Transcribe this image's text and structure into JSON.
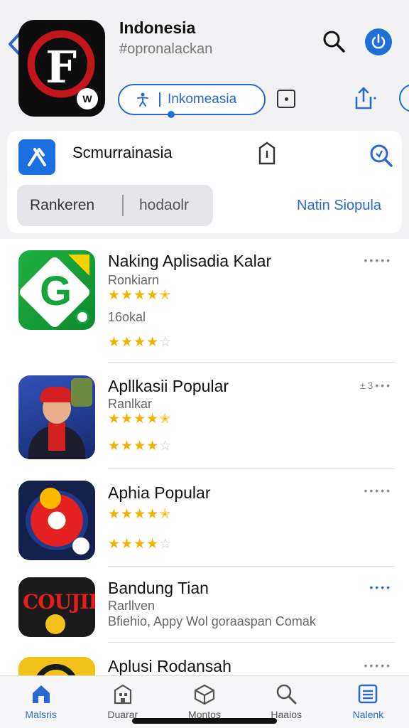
{
  "header": {
    "title": "Indonesia",
    "subtitle": "#opronalackan",
    "app_icon_letter": "F",
    "app_icon_badge": "W",
    "pill_label": "Inkomeasia",
    "icons": [
      "back-chevron-icon",
      "search-icon",
      "power-icon",
      "accessibility-icon",
      "square-icon",
      "share-icon",
      "circle-icon"
    ]
  },
  "search_card": {
    "title": "Scmurrainasia",
    "segment_a": "Rankeren",
    "segment_b": "hodaolr",
    "link": "Natin Siopula",
    "icons": [
      "app-x-icon",
      "tag-icon",
      "search-icon"
    ]
  },
  "list": [
    {
      "name": "Naking Aplisadia Kalar",
      "sub1": "Ronkiarn",
      "stars1": 4.5,
      "sub2": "16okal",
      "stars2": 4,
      "dots": "•••••",
      "dots_color": "gray",
      "icon_text": "G"
    },
    {
      "name": "Apllkasii Popular",
      "sub1": "Ranlkar",
      "stars1": 4.5,
      "stars2": 4,
      "dots": "±3•••",
      "dots_color": "gray",
      "icon_text": ""
    },
    {
      "name": "Aphia Popular",
      "stars1": 4.5,
      "stars2": 4,
      "dots": "•••••",
      "dots_color": "gray",
      "icon_text": ""
    },
    {
      "name": "Bandung Tian",
      "sub1": "Rarllven",
      "sub2": "Bfiehio, Appy Wol goraaspan Comak",
      "dots": "••••",
      "dots_color": "blue",
      "icon_text": "COUJIIA"
    },
    {
      "name": "Aplusi Rodansah",
      "dots": "•••••",
      "dots_color": "gray",
      "icon_text": ""
    }
  ],
  "tabbar": [
    {
      "label": "Malsris",
      "icon": "home-icon",
      "active": true
    },
    {
      "label": "Duarar",
      "icon": "building-icon",
      "active": false
    },
    {
      "label": "Montos",
      "icon": "box-icon",
      "active": false
    },
    {
      "label": "Haaios",
      "icon": "search-icon",
      "active": false
    },
    {
      "label": "Nalenk",
      "icon": "list-icon",
      "active": false
    }
  ],
  "colors": {
    "accent": "#2a6ad0",
    "star": "#f0b400",
    "star_off": "#c9c9c9",
    "background": "#f2f2f5"
  }
}
